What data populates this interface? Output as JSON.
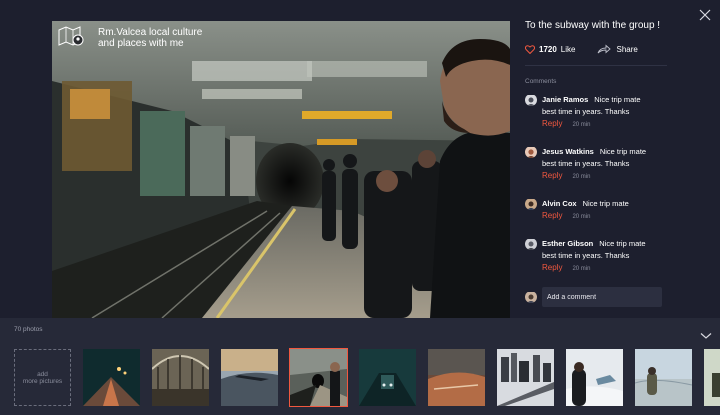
{
  "album": {
    "title_line1": "Rm.Valcea local culture",
    "title_line2": "and places with me",
    "icon": "map-pin-icon"
  },
  "post": {
    "title": "To the subway with the group !",
    "like_count": "1720",
    "like_label": "Like",
    "share_label": "Share"
  },
  "comments": {
    "header": "Comments",
    "items": [
      {
        "name": "Janie Ramos",
        "line1": "Nice trip mate",
        "line2": "best time in years. Thanks",
        "reply": "Reply",
        "time": "20 min"
      },
      {
        "name": "Jesus Watkins",
        "line1": "Nice trip mate",
        "line2": "best time in years. Thanks",
        "reply": "Reply",
        "time": "20 min"
      },
      {
        "name": "Alvin Cox",
        "line1": "Nice trip mate",
        "line2": "",
        "reply": "Reply",
        "time": "20 min"
      },
      {
        "name": "Esther Gibson",
        "line1": "Nice trip mate",
        "line2": "best time in years. Thanks",
        "reply": "Reply",
        "time": "20 min"
      }
    ],
    "add_placeholder": "Add a comment"
  },
  "strip": {
    "photo_count": "70 photos",
    "add_line1": "add",
    "add_line2": "more pictures",
    "selected_index": 3
  },
  "colors": {
    "background": "#1d1f2e",
    "strip_background": "#262938",
    "accent": "#f1583f",
    "muted": "#8a8d9c"
  }
}
